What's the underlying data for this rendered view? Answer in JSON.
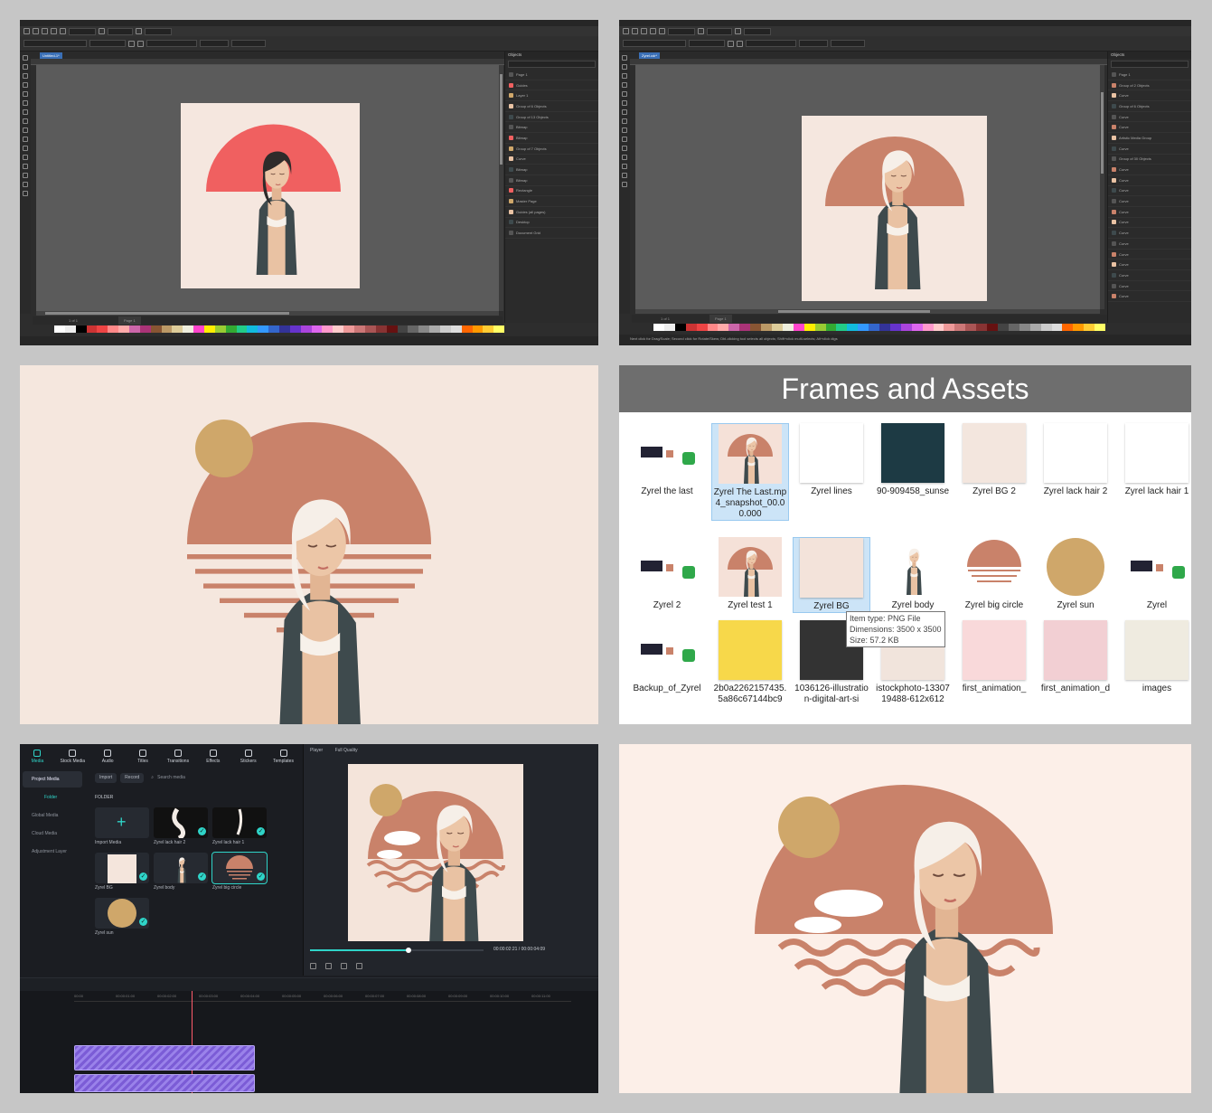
{
  "screens": {
    "corel1": {
      "tab": "Untitled-1*",
      "objects_title": "Objects",
      "rows": [
        "Page 1",
        "Guides",
        "Layer 1",
        "Group of 6 Objects",
        "Group of 13 Objects",
        "Bitmap",
        "Bitmap",
        "Group of 7 Objects",
        "Curve",
        "Bitmap",
        "Bitmap",
        "Rectangle",
        "Master Page",
        "Guides (all pages)",
        "Desktop",
        "Document Grid"
      ],
      "page_label": "Page 1",
      "page_count": "1 of 1"
    },
    "corel2": {
      "tab": "Zyrel.cdr*",
      "objects_title": "Objects",
      "rows": [
        "Page 1",
        "Group of 2 Objects",
        "Curve",
        "Group of 6 Objects",
        "Curve",
        "Curve",
        "Artistic Media Group",
        "Curve",
        "Group of 30 Objects",
        "Curve",
        "Curve",
        "Curve",
        "Curve",
        "Curve",
        "Curve",
        "Curve",
        "Curve",
        "Curve",
        "Curve",
        "Curve",
        "Curve",
        "Curve"
      ],
      "page_label": "Page 1",
      "page_count": "1 of 1",
      "status": "Next click for Drag/Scale; Second click for Rotate/Skew; Dbl-clicking tool selects all objects; Shift+click multi-selects; Alt+click digs"
    },
    "explorer": {
      "title": "Frames and Assets",
      "items": [
        {
          "label": "Zyrel the last"
        },
        {
          "label": "Zyrel The Last.mp4_snapshot_00.00.000"
        },
        {
          "label": "Zyrel lines"
        },
        {
          "label": "90-909458_sunse"
        },
        {
          "label": "Zyrel BG 2"
        },
        {
          "label": "Zyrel lack hair 2"
        },
        {
          "label": "Zyrel lack hair 1"
        },
        {
          "label": "Zyrel 2"
        },
        {
          "label": "Zyrel test 1"
        },
        {
          "label": "Zyrel BG"
        },
        {
          "label": "Zyrel body"
        },
        {
          "label": "Zyrel big circle"
        },
        {
          "label": "Zyrel sun"
        },
        {
          "label": "Zyrel"
        },
        {
          "label": "Backup_of_Zyrel"
        },
        {
          "label": "2b0a2262157435.5a86c67144bc9"
        },
        {
          "label": "1036126-illustration-digital-art-si"
        },
        {
          "label": "istockphoto-1330719488-612x612"
        },
        {
          "label": "first_animation_"
        },
        {
          "label": "first_animation_d"
        },
        {
          "label": "images"
        }
      ],
      "tooltip": {
        "line1": "Item type: PNG File",
        "line2": "Dimensions: 3500 x 3500",
        "line3": "Size: 57.2 KB"
      }
    },
    "filmora": {
      "nav": [
        "Media",
        "Stock Media",
        "Audio",
        "Titles",
        "Transitions",
        "Effects",
        "Stickers",
        "Templates"
      ],
      "side": [
        "Project Media",
        "Folder",
        "Global Media",
        "Cloud Media",
        "Adjustment Layer"
      ],
      "import_label": "Import",
      "record_label": "Record",
      "search_placeholder": "Search media",
      "folder_label": "FOLDER",
      "media": [
        {
          "label": "Import Media"
        },
        {
          "label": "Zyrel lack hair 2"
        },
        {
          "label": "Zyrel lack hair 1"
        },
        {
          "label": "Zyrel BG"
        },
        {
          "label": "Zyrel body"
        },
        {
          "label": "Zyrel big circle"
        },
        {
          "label": "Zyrel sun"
        }
      ],
      "player_label": "Player",
      "quality": "Full Quality",
      "time_current": "00:00:02:21",
      "time_total": "00:00:04:09",
      "progress": 0.57,
      "ruler": [
        "00:00",
        "00:00:01:00",
        "00:00:02:00",
        "00:00:03:00",
        "00:00:04:00",
        "00:00:05:00",
        "00:00:06:00",
        "00:00:07:00",
        "00:00:08:00",
        "00:00:09:00",
        "00:00:10:00",
        "00:00:11:00"
      ]
    }
  },
  "colors": {
    "terracotta": "#c9826a",
    "coral": "#f06060",
    "sun": "#cfa76a",
    "cream": "#f5e7df",
    "jacket": "#3e4a4d",
    "skin": "#e9c2a3",
    "hair": "#f6efe8",
    "accent": "#2fd4c8"
  }
}
